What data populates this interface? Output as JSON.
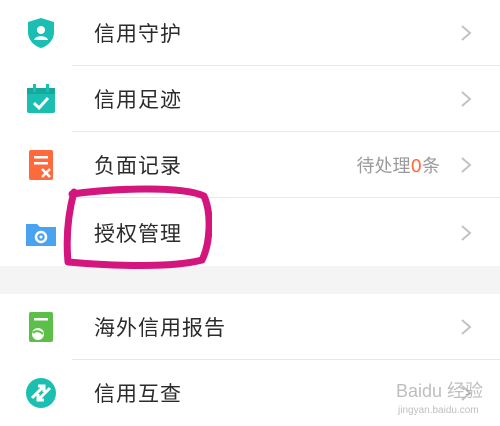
{
  "menu": {
    "items": [
      {
        "label": "信用守护",
        "icon": "shield-user-icon"
      },
      {
        "label": "信用足迹",
        "icon": "calendar-check-icon"
      },
      {
        "label": "负面记录",
        "icon": "document-x-icon"
      },
      {
        "label": "授权管理",
        "icon": "folder-gear-icon"
      }
    ],
    "negative_status": {
      "prefix": "待处理",
      "count": "0",
      "suffix": "条"
    }
  },
  "menu2": {
    "items": [
      {
        "label": "海外信用报告",
        "icon": "report-globe-icon"
      },
      {
        "label": "信用互查",
        "icon": "swap-circle-icon"
      }
    ]
  },
  "watermark": {
    "text": "Baidu 经验",
    "sub": "jingyan.baidu.com"
  },
  "colors": {
    "teal": "#1bbfb1",
    "orange": "#ff6a3c",
    "blue": "#4aa3f0",
    "green": "#5cbf4a",
    "annotation": "#d4157e"
  }
}
